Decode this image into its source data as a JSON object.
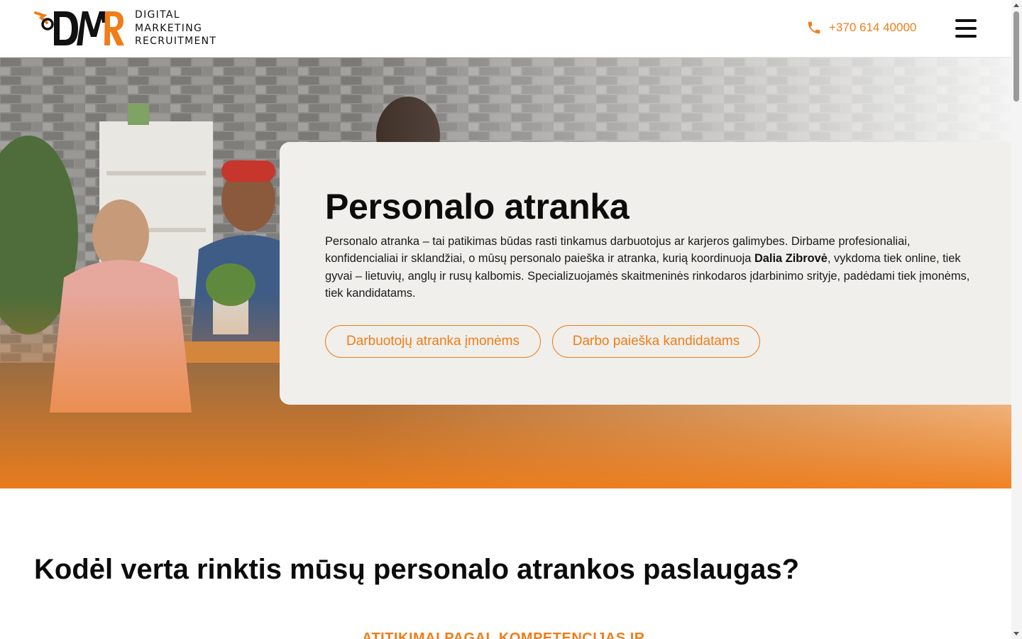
{
  "header": {
    "logo_lines": [
      "DIGITAL",
      "MARKETING",
      "RECRUITMENT"
    ],
    "logo_mark": "DMR",
    "phone_icon": "phone-icon",
    "phone": "+370 614 40000",
    "menu_icon": "hamburger-menu-icon"
  },
  "hero": {
    "title": "Personalo atranka",
    "text_before": "Personalo atranka – tai patikimas būdas rasti tinkamus darbuotojus ar karjeros galimybes. Dirbame profesionaliai, konfidencialiai ir sklandžiai, o mūsų personalo paieška ir atranka, kurią koordinuoja ",
    "text_bold": "Dalia Zibrovė",
    "text_after": ", vykdoma tiek online, tiek gyvai – lietuvių, anglų ir rusų kalbomis. Specializuojamės skaitmeninės rinkodaros įdarbinimo srityje, padėdami tiek įmonėms, tiek kandidatams.",
    "buttons": [
      "Darbuotojų atranka įmonėms",
      "Darbo paieška kandidatams"
    ]
  },
  "section": {
    "title": "Kodėl verta rinktis mūsų personalo atrankos paslaugas?",
    "subtitle": "ATITIKIMAI PAGAL KOMPETENCIJAS IR"
  },
  "colors": {
    "accent": "#ef7d1a",
    "card_bg": "#f0efeb",
    "text": "#111111"
  }
}
